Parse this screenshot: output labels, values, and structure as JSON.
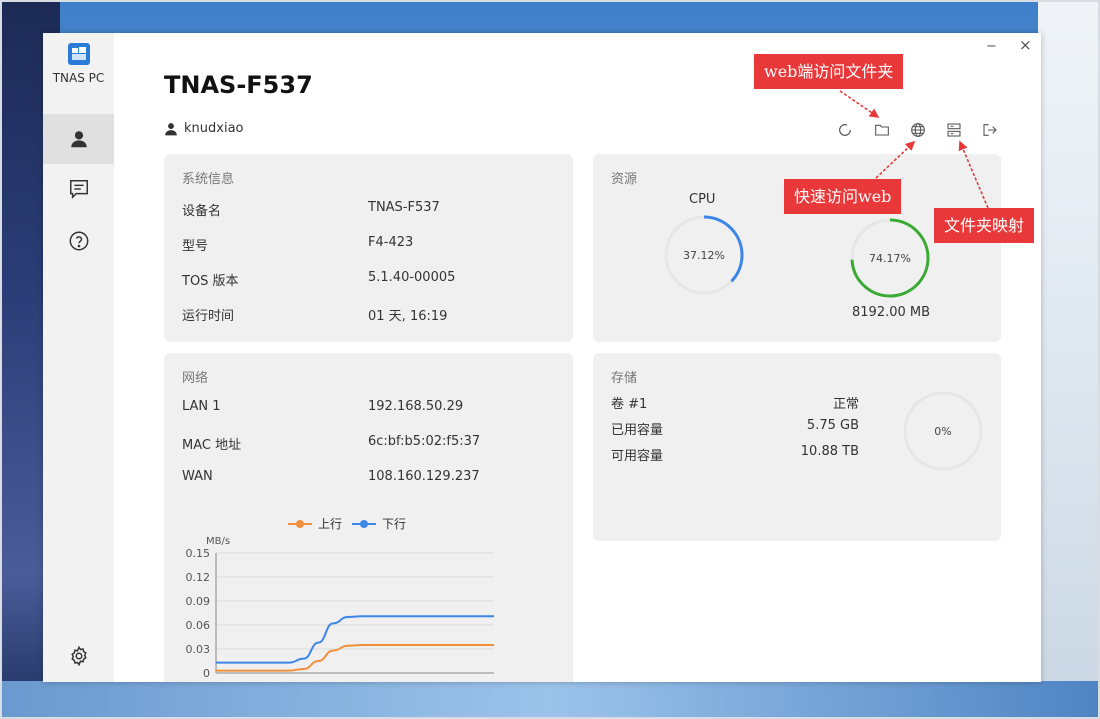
{
  "app": {
    "name": "TNAS PC"
  },
  "window": {
    "minimize_glyph": "−",
    "close_glyph": "×"
  },
  "header": {
    "device_title": "TNAS-F537",
    "username": "knudxiao"
  },
  "toolbar": [
    {
      "icon": "refresh-icon"
    },
    {
      "icon": "folder-icon"
    },
    {
      "icon": "globe-icon"
    },
    {
      "icon": "folder-mapping-icon"
    },
    {
      "icon": "logout-icon"
    }
  ],
  "sidebar": [
    {
      "icon": "user-icon",
      "active": true
    },
    {
      "icon": "message-icon",
      "active": false
    },
    {
      "icon": "help-icon",
      "active": false
    },
    {
      "icon": "settings-icon",
      "active": false
    }
  ],
  "system_info": {
    "title": "系统信息",
    "rows": [
      {
        "label": "设备名",
        "value": "TNAS-F537"
      },
      {
        "label": "型号",
        "value": "F4-423"
      },
      {
        "label": "TOS 版本",
        "value": "5.1.40-00005"
      },
      {
        "label": "运行时间",
        "value": "01 天, 16:19"
      }
    ]
  },
  "resources": {
    "title": "资源",
    "cpu": {
      "label": "CPU",
      "percent_text": "37.12%",
      "value": 37.12,
      "color": "#3b86e8"
    },
    "memory": {
      "percent_text": "74.17%",
      "value": 74.17,
      "total": "8192.00 MB",
      "color": "#3aaa35"
    }
  },
  "network": {
    "title": "网络",
    "rows": [
      {
        "label": "LAN 1",
        "value": "192.168.50.29"
      },
      {
        "label": "MAC 地址",
        "value": "6c:bf:b5:02:f5:37"
      },
      {
        "label": "WAN",
        "value": "108.160.129.237"
      }
    ]
  },
  "storage": {
    "title": "存储",
    "rows": [
      {
        "label": "卷 #1",
        "value": "正常"
      },
      {
        "label": "已用容量",
        "value": "5.75 GB"
      },
      {
        "label": "可用容量",
        "value": "10.88 TB"
      }
    ],
    "usage_text": "0%",
    "usage_value": 0
  },
  "chart_data": {
    "type": "line",
    "ylabel": "MB/s",
    "ylim": [
      0,
      0.15
    ],
    "yticks": [
      "0.15",
      "0.12",
      "0.09",
      "0.06",
      "0.03",
      "0"
    ],
    "legend_position": "top",
    "grid": true,
    "series": [
      {
        "name": "上行",
        "color": "#f0903a",
        "values": [
          0.003,
          0.003,
          0.003,
          0.003,
          0.003,
          0.003,
          0.005,
          0.015,
          0.028,
          0.034,
          0.035,
          0.035,
          0.035,
          0.035,
          0.035,
          0.035,
          0.035,
          0.035,
          0.035,
          0.035
        ]
      },
      {
        "name": "下行",
        "color": "#3b86e8",
        "values": [
          0.013,
          0.013,
          0.013,
          0.013,
          0.013,
          0.013,
          0.018,
          0.038,
          0.062,
          0.07,
          0.071,
          0.071,
          0.071,
          0.071,
          0.071,
          0.071,
          0.071,
          0.071,
          0.071,
          0.071
        ]
      }
    ]
  },
  "annotations": {
    "web_folder": "web端访问文件夹",
    "quick_web": "快速访问web",
    "folder_mapping": "文件夹映射"
  }
}
